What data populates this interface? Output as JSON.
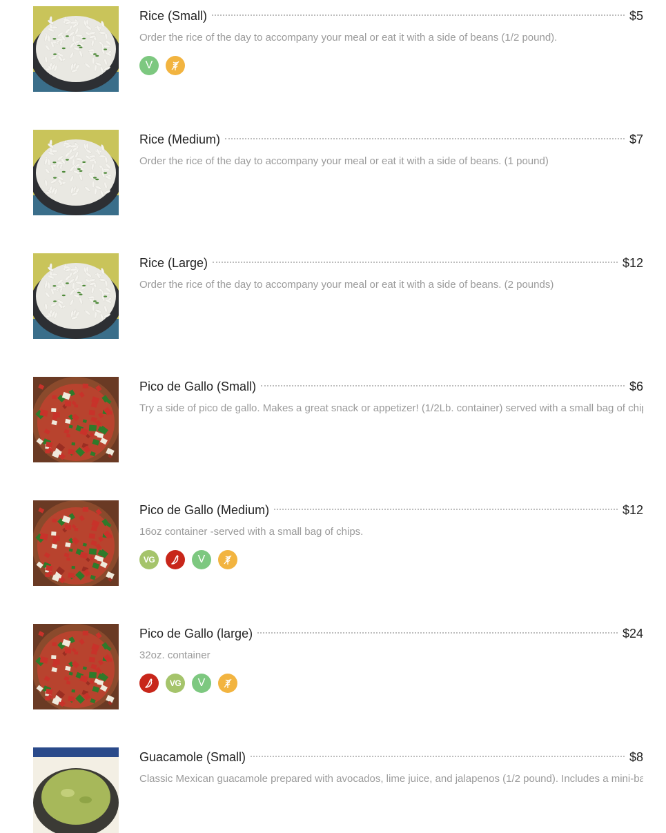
{
  "menu": {
    "items": [
      {
        "name": "Rice (Small)",
        "price": "$5",
        "description": "Order the rice of the day to accompany your meal or eat it with a side of beans (1/2 pound).",
        "image": "rice-bowl",
        "badges": [
          {
            "type": "vegetarian",
            "text": "V"
          },
          {
            "type": "gluten-free",
            "text": ""
          }
        ]
      },
      {
        "name": "Rice (Medium)",
        "price": "$7",
        "description": "Order the rice of the day to accompany your meal or eat it with a side of beans. (1 pound)",
        "image": "rice-bowl",
        "badges": []
      },
      {
        "name": "Rice (Large)",
        "price": "$12",
        "description": "Order the rice of the day to accompany your meal or eat it with a side of beans. (2 pounds)",
        "image": "rice-bowl",
        "badges": []
      },
      {
        "name": "Pico de Gallo (Small)",
        "price": "$6",
        "description": "Try a side of pico de gallo. Makes a great snack or appetizer! (1/2Lb. container) served with a small bag of chips.",
        "image": "pico-bowl",
        "badges": []
      },
      {
        "name": "Pico de Gallo (Medium)",
        "price": "$12",
        "description": "16oz container -served with a small bag of chips.",
        "image": "pico-bowl",
        "badges": [
          {
            "type": "vegan",
            "text": "VG"
          },
          {
            "type": "spicy",
            "text": ""
          },
          {
            "type": "vegetarian",
            "text": "V"
          },
          {
            "type": "gluten-free",
            "text": ""
          }
        ]
      },
      {
        "name": "Pico de Gallo (large)",
        "price": "$24",
        "description": "32oz. container",
        "image": "pico-bowl",
        "badges": [
          {
            "type": "spicy",
            "text": ""
          },
          {
            "type": "vegan",
            "text": "VG"
          },
          {
            "type": "vegetarian",
            "text": "V"
          },
          {
            "type": "gluten-free",
            "text": ""
          }
        ]
      },
      {
        "name": "Guacamole (Small)",
        "price": "$8",
        "description": "Classic Mexican guacamole prepared with avocados, lime juice, and jalapenos (1/2 pound). Includes a mini-bag",
        "image": "guacamole-bowl",
        "badges": []
      }
    ]
  },
  "colors": {
    "vegetarian": "#7dc880",
    "vegan": "#a5c46b",
    "spicy": "#c8261a",
    "gluten-free": "#f2b440",
    "description_text": "#9a9a9a",
    "dot_leader": "#bdbdbd"
  }
}
